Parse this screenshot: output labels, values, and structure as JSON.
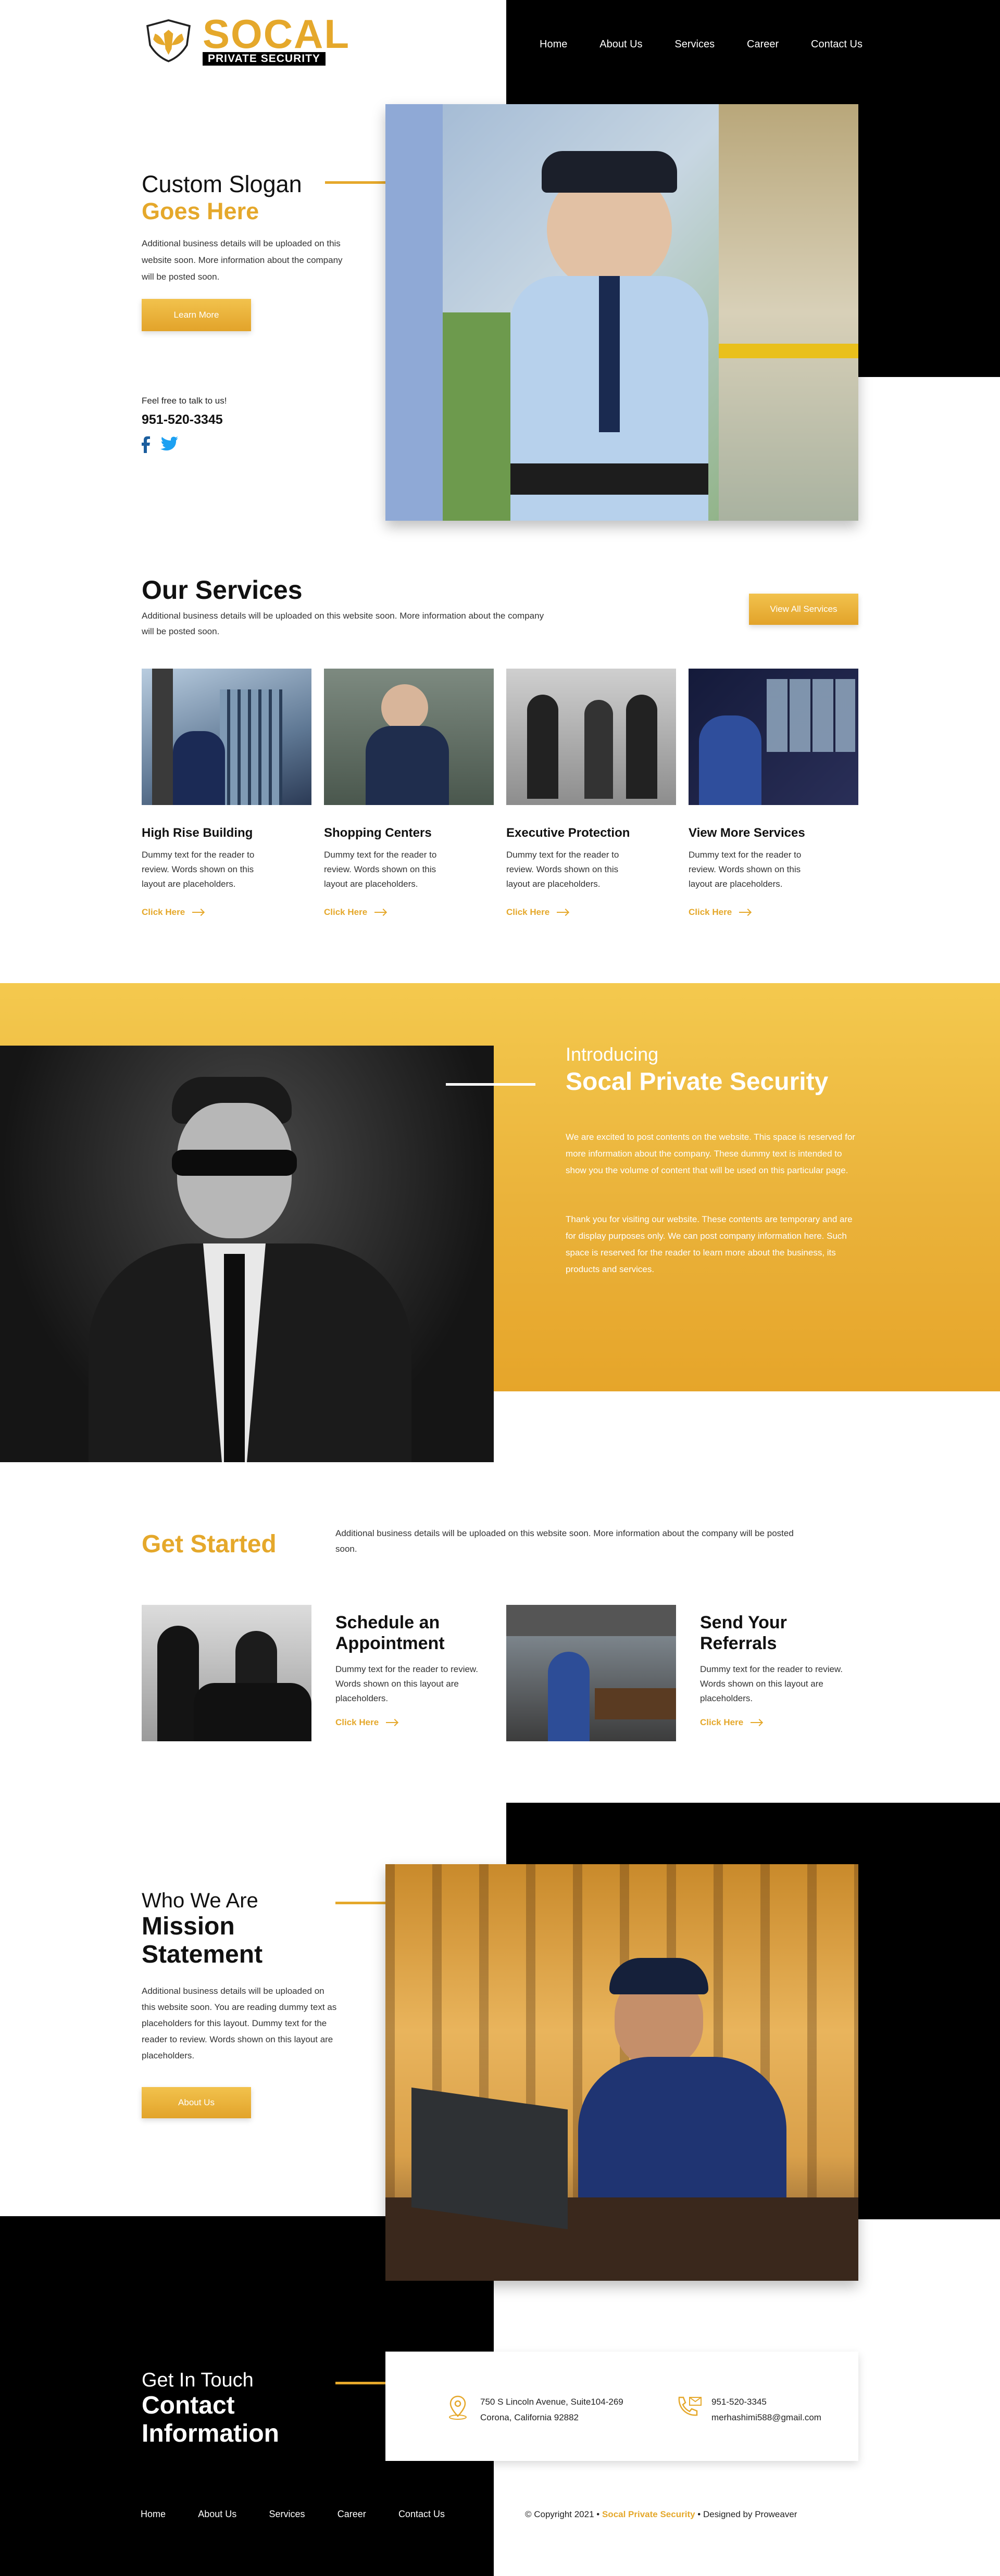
{
  "logo": {
    "name": "SOCAL",
    "tag": "PRIVATE SECURITY"
  },
  "nav": [
    "Home",
    "About Us",
    "Services",
    "Career",
    "Contact Us"
  ],
  "hero": {
    "slogan_line1": "Custom Slogan",
    "slogan_line2": "Goes Here",
    "text": "Additional business details will be uploaded on this website soon. More information about the company will be posted soon.",
    "button": "Learn More",
    "talk": "Feel free to talk to us!",
    "phone": "951-520-3345"
  },
  "services": {
    "title": "Our Services",
    "text": "Additional business details will be uploaded on this website soon. More information about the company will be posted soon.",
    "button": "View All Services",
    "cards": [
      {
        "title": "High Rise Building",
        "text": "Dummy text for the reader to review. Words shown on this layout are placeholders.",
        "link": "Click Here"
      },
      {
        "title": "Shopping Centers",
        "text": "Dummy text for the reader to review. Words shown on this layout are placeholders.",
        "link": "Click Here"
      },
      {
        "title": "Executive Protection",
        "text": "Dummy text for the reader to review. Words shown on this layout are placeholders.",
        "link": "Click Here"
      },
      {
        "title": "View More Services",
        "text": "Dummy text for the reader to review. Words shown on this layout are placeholders.",
        "link": "Click Here"
      }
    ]
  },
  "intro": {
    "small": "Introducing",
    "big": "Socal Private Security",
    "p1": "We are excited to post contents on the website. This space is reserved for more information about the company. These dummy text is intended to show you the volume of content that will be used on this particular page.",
    "p2": "Thank you for visiting our website. These contents are temporary and are for display purposes only. We can post company information here. Such space is reserved for the reader to learn more about the business, its products and services."
  },
  "started": {
    "title": "Get Started",
    "text": "Additional business details will be uploaded on this website soon. More information about the company will be posted soon.",
    "cards": [
      {
        "title": "Schedule an Appointment",
        "text": "Dummy text for the reader to review. Words shown on this layout are placeholders.",
        "link": "Click Here"
      },
      {
        "title": "Send Your Referrals",
        "text": "Dummy text for the reader to review. Words shown on this layout are placeholders.",
        "link": "Click Here"
      }
    ]
  },
  "mission": {
    "small": "Who We Are",
    "big": "Mission Statement",
    "text": "Additional business details will be uploaded on this website soon. You are reading dummy text as placeholders for this layout. Dummy text for the reader to review. Words shown on this layout are placeholders.",
    "button": "About Us"
  },
  "contact": {
    "small": "Get In Touch",
    "big": "Contact Information",
    "address1": "750 S Lincoln Avenue, Suite104-269",
    "address2": "Corona, California 92882",
    "phone": "951-520-3345",
    "email": "merhashimi588@gmail.com"
  },
  "footer": {
    "links": [
      "Home",
      "About Us",
      "Services",
      "Career",
      "Contact Us"
    ],
    "copy": "© Copyright 2021 •",
    "brand": "Socal Private Security",
    "designed": "• Designed by Proweaver"
  },
  "colors": {
    "accent": "#e5a82b",
    "dark": "#000000"
  }
}
